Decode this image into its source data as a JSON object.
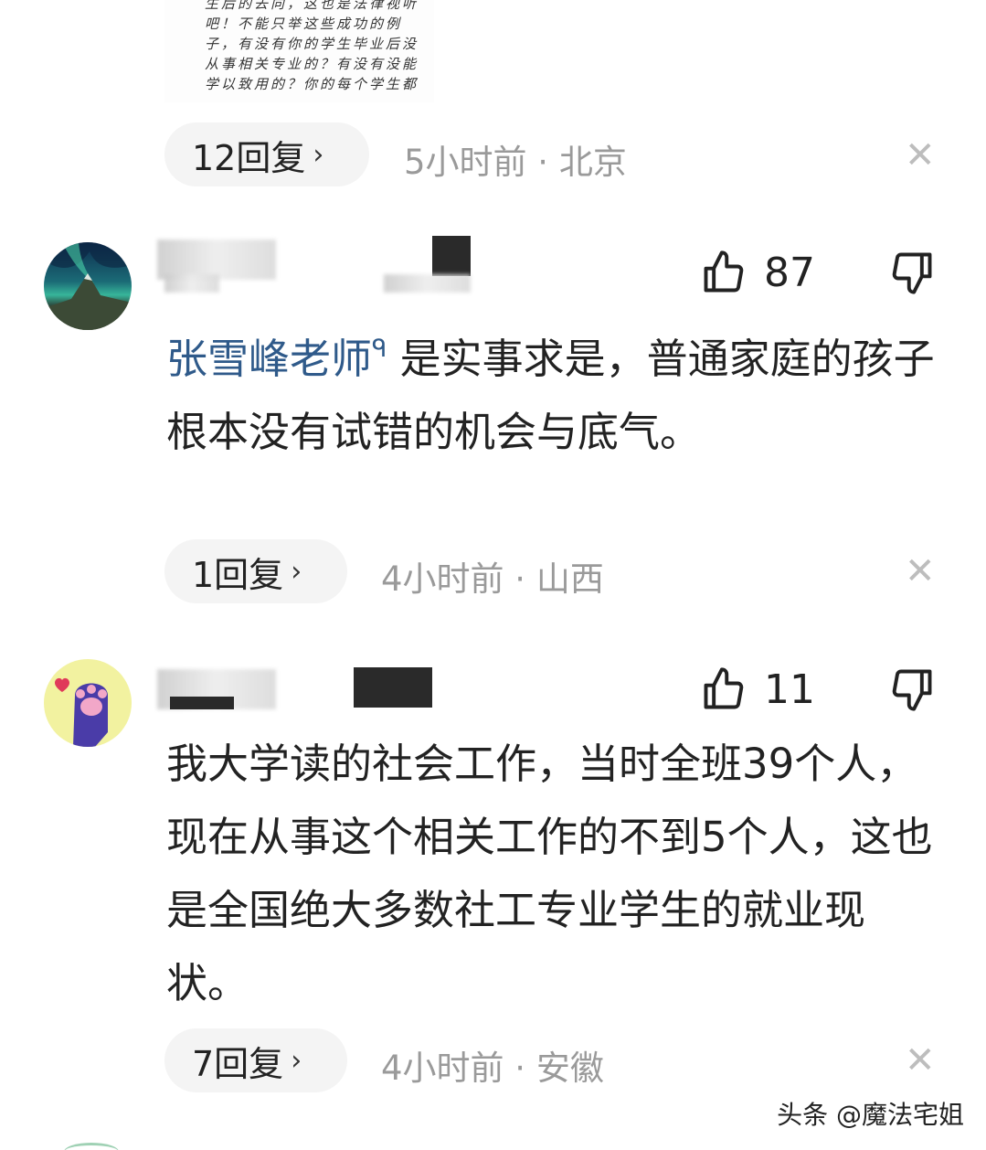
{
  "top_image": {
    "lines": [
      "生后的去向，这也是法律视听",
      "吧！不能只举这些成功的例",
      "子，有没有你的学生毕业后没",
      "从事相关专业的？有没有没能",
      "学以致用的？你的每个学生都"
    ]
  },
  "comments": [
    {
      "replies": "12回复",
      "chevron": "›",
      "meta": "5小时前 · 北京",
      "close": "✕"
    },
    {
      "likes": "87",
      "mention": "张雪峰老师",
      "mention_icon": "ᑫ",
      "text": "是实事求是，普通家庭的孩子根本没有试错的机会与底气。",
      "replies": "1回复",
      "chevron": "›",
      "meta": "4小时前 · 山西",
      "close": "✕"
    },
    {
      "likes": "11",
      "text": "我大学读的社会工作，当时全班39个人，现在从事这个相关工作的不到5个人，这也是全国绝大多数社工专业学生的就业现状。",
      "replies": "7回复",
      "chevron": "›",
      "meta": "4小时前 · 安徽",
      "close": "✕"
    }
  ],
  "watermark": "头条 @魔法宅姐",
  "icons": {
    "like": "thumbs-up-icon",
    "dislike": "thumbs-down-icon",
    "close": "close-icon",
    "chevron": "chevron-right-icon"
  },
  "colors": {
    "mention": "#2f5a8a",
    "meta": "#9a9a9a",
    "pill": "#f4f4f4"
  }
}
